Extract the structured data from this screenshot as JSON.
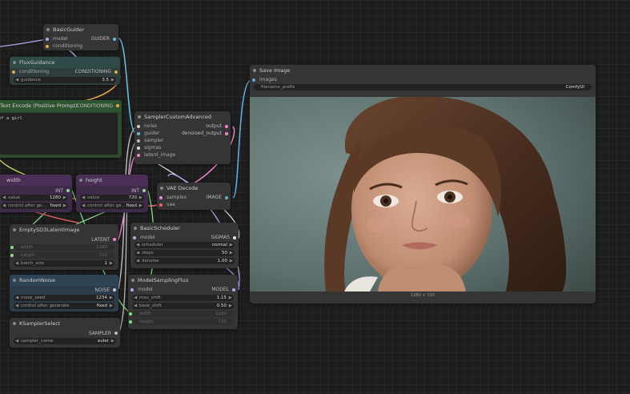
{
  "colors": {
    "background": "#1d1d1d",
    "node_body": "#353535",
    "green_node": "#2c4a2c",
    "purple_node": "#3e2b4a",
    "blue_node": "#2c3c4a",
    "socket_conditioning": "#e8a84a",
    "socket_guider": "#66bbdd",
    "socket_int": "#88dd88",
    "socket_latent": "#ee88cc",
    "socket_image": "#66aadd",
    "socket_vae": "#ee6666",
    "socket_model": "#aaaaee",
    "socket_sampler": "#bbbbbb",
    "socket_noise": "#cccccc",
    "socket_sigmas": "#dddddd"
  },
  "nodes": {
    "basic_guider": {
      "title": "BasicGuider",
      "inputs": [
        "model",
        "conditioning"
      ],
      "output": "GUIDER"
    },
    "flux_guidance": {
      "title": "FluxGuidance",
      "input": "conditioning",
      "output": "CONDITIONING",
      "widget_label": "guidance",
      "widget_value": "3.5"
    },
    "text_encode": {
      "title": "Text Encode (Positive Prompt)",
      "output": "CONDITIONING",
      "prompt_text": "of a girl"
    },
    "sampler_custom_advanced": {
      "title": "SamplerCustomAdvanced",
      "inputs": [
        "noise",
        "guider",
        "sampler",
        "sigmas",
        "latent_image"
      ],
      "outputs": [
        "output",
        "denoised_output"
      ]
    },
    "width": {
      "title": "width",
      "output": "INT",
      "value_label": "value",
      "value": "1280",
      "control_label": "control after ge…",
      "control_value": "fixed"
    },
    "height": {
      "title": "height",
      "output": "INT",
      "value_label": "value",
      "value": "720",
      "control_label": "control after ge…",
      "control_value": "fixed"
    },
    "vae_decode": {
      "title": "VAE Decode",
      "inputs": [
        "samples",
        "vae"
      ],
      "output": "IMAGE"
    },
    "empty_latent": {
      "title": "EmptySD3LatentImage",
      "output": "LATENT",
      "widgets": [
        {
          "label": "width",
          "value": "1280"
        },
        {
          "label": "height",
          "value": "720"
        },
        {
          "label": "batch_size",
          "value": "1"
        }
      ]
    },
    "basic_scheduler": {
      "title": "BasicScheduler",
      "input": "model",
      "output": "SIGMAS",
      "widgets": [
        {
          "label": "scheduler",
          "value": "normal"
        },
        {
          "label": "steps",
          "value": "50"
        },
        {
          "label": "denoise",
          "value": "1.00"
        }
      ]
    },
    "random_noise": {
      "title": "RandomNoise",
      "output": "NOISE",
      "widgets": [
        {
          "label": "noise_seed",
          "value": "1234"
        },
        {
          "label": "control after generate",
          "value": "fixed"
        }
      ]
    },
    "model_sampling_flux": {
      "title": "ModelSamplingFlux",
      "input": "model",
      "output": "MODEL",
      "widgets": [
        {
          "label": "max_shift",
          "value": "1.15"
        },
        {
          "label": "base_shift",
          "value": "0.50"
        },
        {
          "label": "width",
          "value": "1280"
        },
        {
          "label": "height",
          "value": "720"
        }
      ]
    },
    "ksampler_select": {
      "title": "KSamplerSelect",
      "output": "SAMPLER",
      "widget_label": "sampler_name",
      "widget_value": "euler"
    },
    "save_image": {
      "title": "Save Image",
      "input": "images",
      "widget_label": "filename_prefix",
      "widget_value": "ComfyUI",
      "image_caption": "1280 × 720"
    }
  }
}
